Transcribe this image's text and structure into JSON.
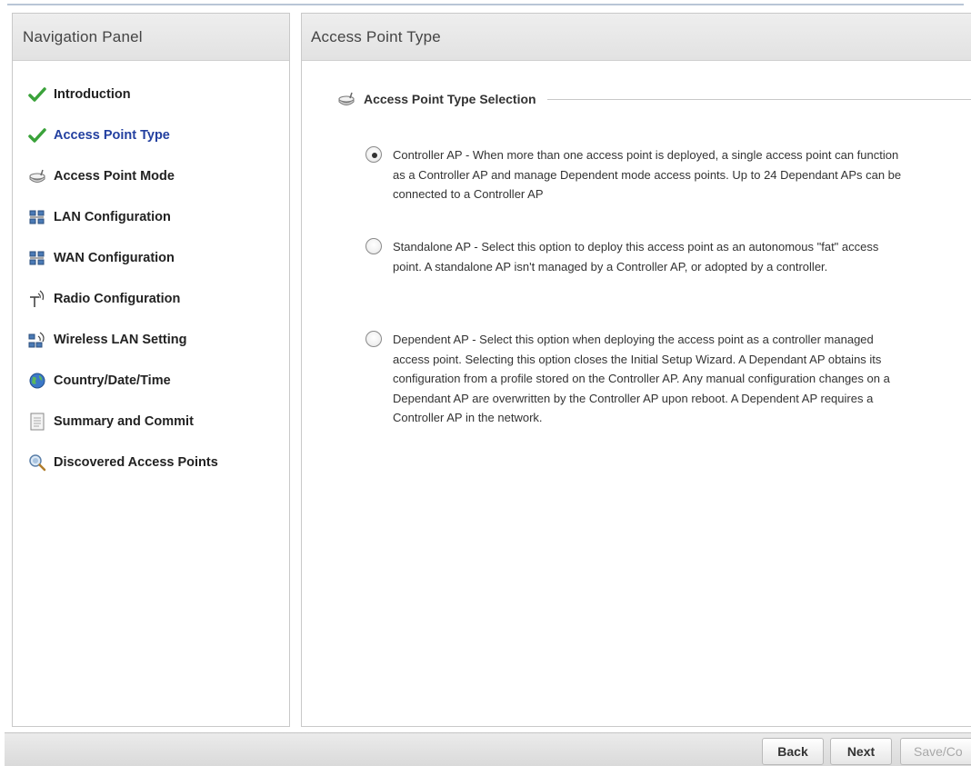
{
  "nav": {
    "title": "Navigation Panel",
    "items": [
      {
        "label": "Introduction",
        "icon": "check-icon"
      },
      {
        "label": "Access Point Type",
        "icon": "check-icon",
        "active": true
      },
      {
        "label": "Access Point Mode",
        "icon": "access-point-icon"
      },
      {
        "label": "LAN Configuration",
        "icon": "network-icon"
      },
      {
        "label": "WAN Configuration",
        "icon": "network-icon"
      },
      {
        "label": "Radio Configuration",
        "icon": "antenna-icon"
      },
      {
        "label": "Wireless LAN Setting",
        "icon": "wireless-network-icon"
      },
      {
        "label": "Country/Date/Time",
        "icon": "globe-icon"
      },
      {
        "label": "Summary and Commit",
        "icon": "document-icon"
      },
      {
        "label": "Discovered Access Points",
        "icon": "search-icon"
      }
    ]
  },
  "content": {
    "title": "Access Point Type",
    "section_title": "Access Point Type Selection",
    "options": [
      {
        "text": "Controller AP - When more than one access point is deployed, a single access point can function as a Controller AP and manage Dependent mode access points. Up to 24 Dependant APs can be connected to a Controller AP",
        "checked": true
      },
      {
        "text": "Standalone AP - Select this option to deploy this access point as an autonomous \"fat\" access point. A standalone AP isn't managed by a Controller AP, or adopted by a controller.",
        "checked": false
      },
      {
        "text": "Dependent AP - Select this option when deploying the access point as a controller managed access point. Selecting this option closes the Initial Setup Wizard. A Dependant AP obtains its configuration from a profile stored on the Controller AP. Any manual configuration changes on a Dependant AP are overwritten by the Controller AP upon reboot. A Dependent AP requires a Controller AP in the network.",
        "checked": false
      }
    ]
  },
  "footer": {
    "back_label": "Back",
    "next_label": "Next",
    "save_label": "Save/Co"
  },
  "colors": {
    "active_nav": "#2340a0",
    "check": "#3aa23a"
  }
}
